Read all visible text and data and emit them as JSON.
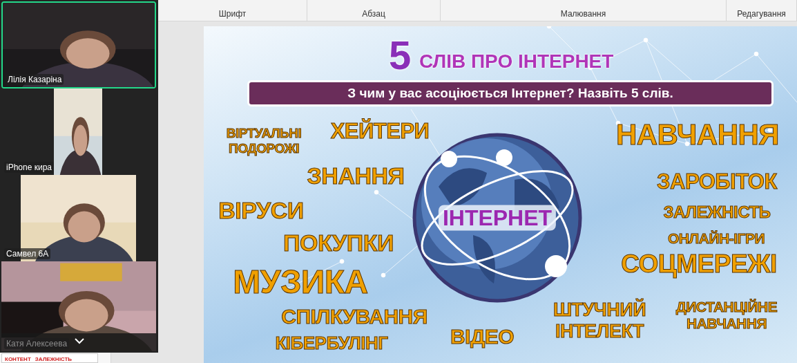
{
  "ribbon": {
    "groups": [
      {
        "label": "Шрифт"
      },
      {
        "label": "Абзац"
      },
      {
        "label": "Малювання"
      },
      {
        "label": "Редагування"
      }
    ]
  },
  "thumbnail": {
    "words": [
      "КОНТЕНТ",
      "ЗАЛЕЖНІСТЬ"
    ]
  },
  "slide": {
    "title_number": "5",
    "title": "СЛІВ ПРО ІНТЕРНЕТ",
    "question": "З чим у вас асоціюється Інтернет? Назвіть 5 слів.",
    "globe_label": "ІНТЕРНЕТ",
    "words": [
      "ВІРТУАЛЬНІ ПОДОРОЖІ",
      "ХЕЙТЕРИ",
      "НАВЧАННЯ",
      "ЗНАННЯ",
      "ЗАРОБІТОК",
      "ВІРУСИ",
      "ЗАЛЕЖНІСТЬ",
      "ПОКУПКИ",
      "ОНЛАЙН-ІГРИ",
      "СОЦМЕРЕЖІ",
      "МУЗИКА",
      "СПІЛКУВАННЯ",
      "ШТУЧНИЙ ІНТЕЛЕКТ",
      "ДИСТАНЦІЙНЕ НАВЧАННЯ",
      "ВІДЕО",
      "КІБЕРБУЛІНГ"
    ]
  },
  "video_panel": {
    "participants": [
      {
        "name": "Лілія Казаріна",
        "speaking": true
      },
      {
        "name": "iPhone кира",
        "speaking": false
      },
      {
        "name": "Самвел 6А",
        "speaking": false
      },
      {
        "name": "Катя Алексеева",
        "speaking": false
      }
    ]
  }
}
